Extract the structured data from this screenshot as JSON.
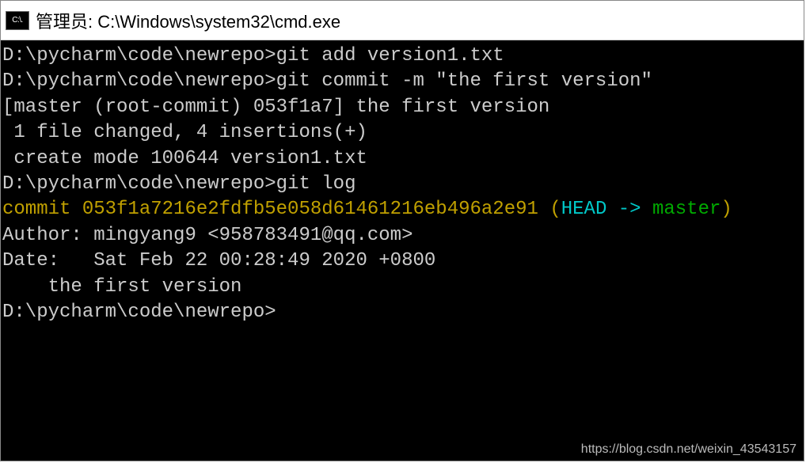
{
  "titlebar": {
    "icon_text": "C:\\.",
    "title": "管理员: C:\\Windows\\system32\\cmd.exe"
  },
  "terminal": {
    "blank": "",
    "line1_prompt": "D:\\pycharm\\code\\newrepo>",
    "line1_cmd": "git add version1.txt",
    "line2_prompt": "D:\\pycharm\\code\\newrepo>",
    "line2_cmd": "git commit -m \"the first version\"",
    "line3": "[master (root-commit) 053f1a7] the first version",
    "line4": " 1 file changed, 4 insertions(+)",
    "line5": " create mode 100644 version1.txt",
    "line6_prompt": "D:\\pycharm\\code\\newrepo>",
    "line6_cmd": "git log",
    "commit_hash": "commit 053f1a7216e2fdfb5e058d61461216eb496a2e91",
    "head_open": " (",
    "head_text": "HEAD -> ",
    "master_text": "master",
    "head_close": ")",
    "author": "Author: mingyang9 <958783491@qq.com>",
    "date": "Date:   Sat Feb 22 00:28:49 2020 +0800",
    "commit_msg": "    the first version",
    "final_prompt": "D:\\pycharm\\code\\newrepo>"
  },
  "watermark": "https://blog.csdn.net/weixin_43543157"
}
